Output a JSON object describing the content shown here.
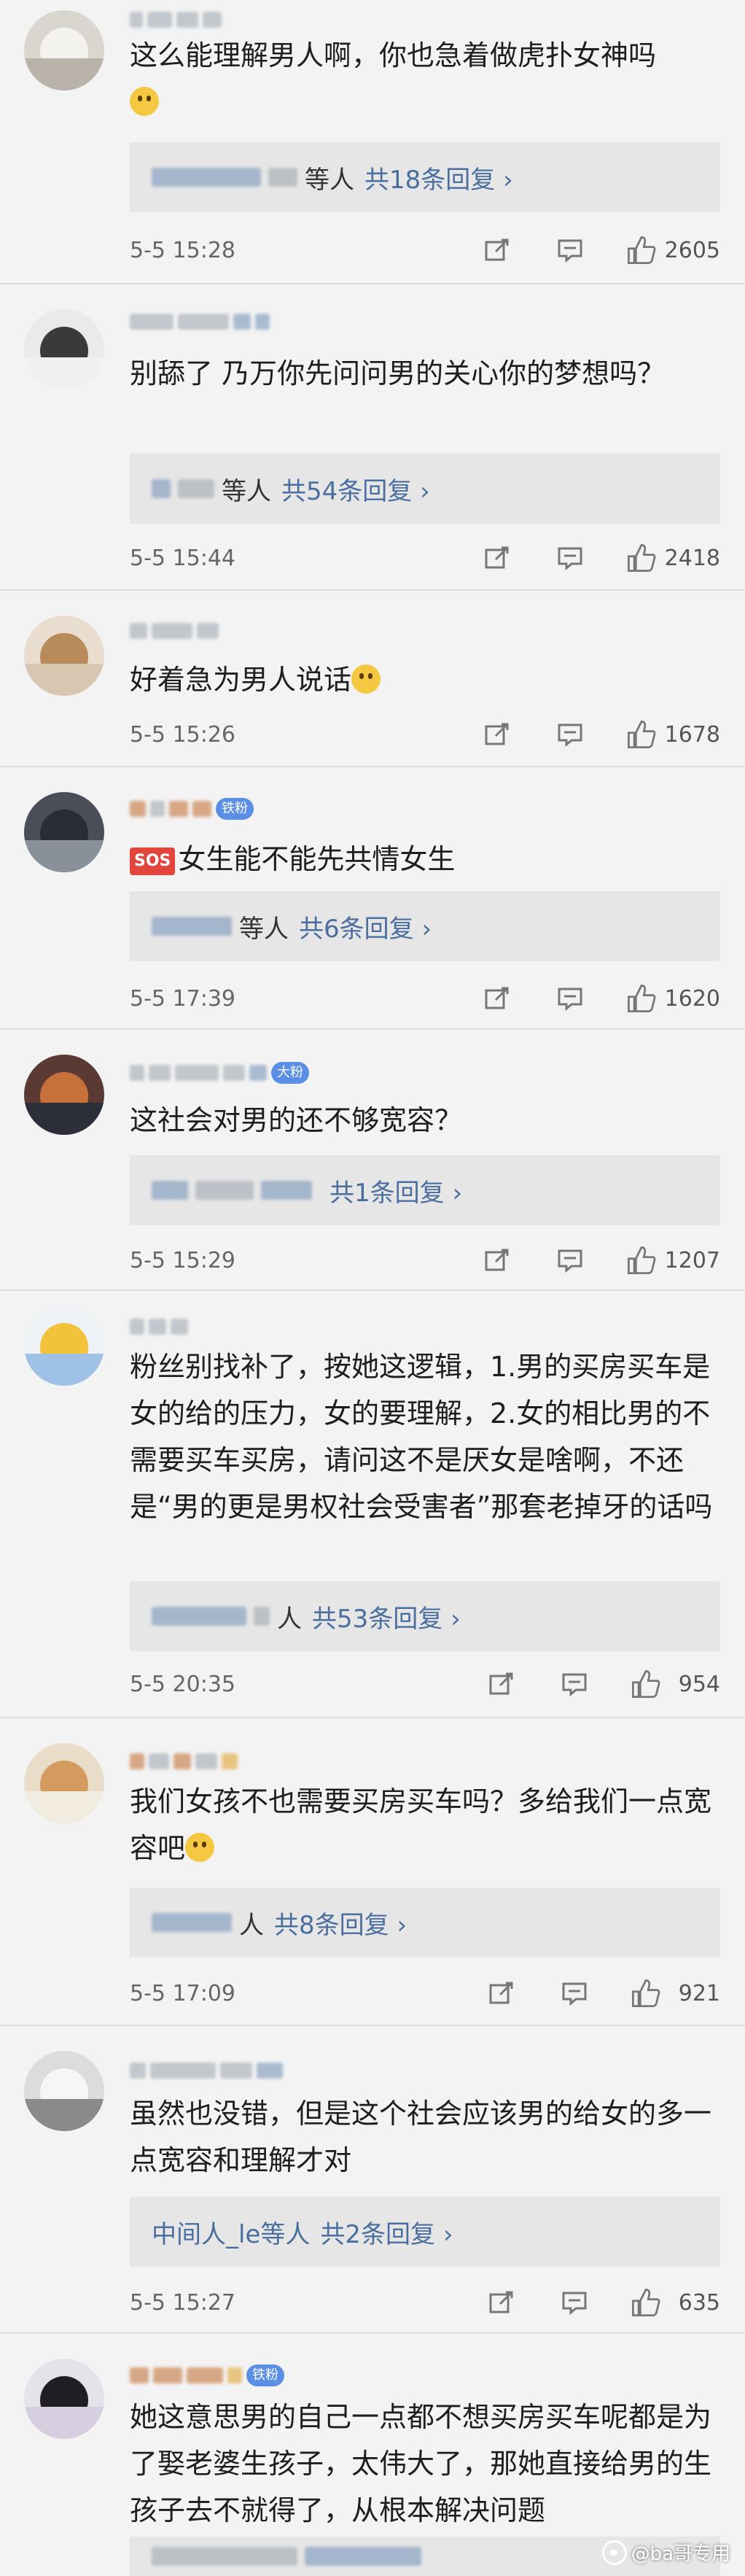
{
  "colors": {
    "link": "#4a6f9e",
    "badge": "#5b8fe6",
    "background": "#f3f3f3",
    "reply_bg": "#e6e6e6"
  },
  "icons": {
    "repost": "share-square-icon",
    "comment": "speech-bubble-icon",
    "like": "thumbs-up-icon"
  },
  "comments": [
    {
      "text": "这么能理解男人啊，你也急着做虎扑女神吗",
      "emoji": "face-emoji",
      "reply_who": "等人",
      "reply_more": "共18条回复",
      "time": "5-5 15:28",
      "likes": "2605",
      "badge": ""
    },
    {
      "text": "别舔了 乃万你先问问男的关心你的梦想吗？",
      "reply_who": "等人",
      "reply_more": "共54条回复",
      "time": "5-5 15:44",
      "likes": "2418",
      "badge": ""
    },
    {
      "text": "好着急为男人说话",
      "emoji": "smile-emoji",
      "time": "5-5 15:26",
      "likes": "1678",
      "badge": ""
    },
    {
      "text": "女生能不能先共情女生",
      "sos": "SOS",
      "reply_who": "等人",
      "reply_more": "共6条回复",
      "time": "5-5 17:39",
      "likes": "1620",
      "badge": "铁粉"
    },
    {
      "text": "这社会对男的还不够宽容？",
      "reply_who": "",
      "reply_more": "共1条回复",
      "time": "5-5 15:29",
      "likes": "1207",
      "badge": "大粉"
    },
    {
      "text": "粉丝别找补了，按她这逻辑，1.男的买房买车是女的给的压力，女的要理解，2.女的相比男的不需要买车买房，请问这不是厌女是啥啊，不还是“男的更是男权社会受害者”那套老掉牙的话吗",
      "reply_who": "人",
      "reply_more": "共53条回复",
      "time": "5-5 20:35",
      "likes": "954",
      "badge": ""
    },
    {
      "text": "我们女孩不也需要买房买车吗？多给我们一点宽容吧",
      "emoji": "pleading-emoji",
      "reply_who": "人",
      "reply_more": "共8条回复",
      "time": "5-5 17:09",
      "likes": "921",
      "badge": ""
    },
    {
      "text": "虽然也没错，但是这个社会应该男的给女的多一点宽容和理解才对",
      "reply_who": "中间人_le等人",
      "reply_more": "共2条回复",
      "time": "5-5 15:27",
      "likes": "635",
      "badge": ""
    },
    {
      "text": "她这意思男的自己一点都不想买房买车呢都是为了娶老婆生孩子，太伟大了，那她直接给男的生孩子去不就得了，从根本解决问题",
      "badge": "铁粉"
    }
  ],
  "watermark": "@ba哥专用"
}
